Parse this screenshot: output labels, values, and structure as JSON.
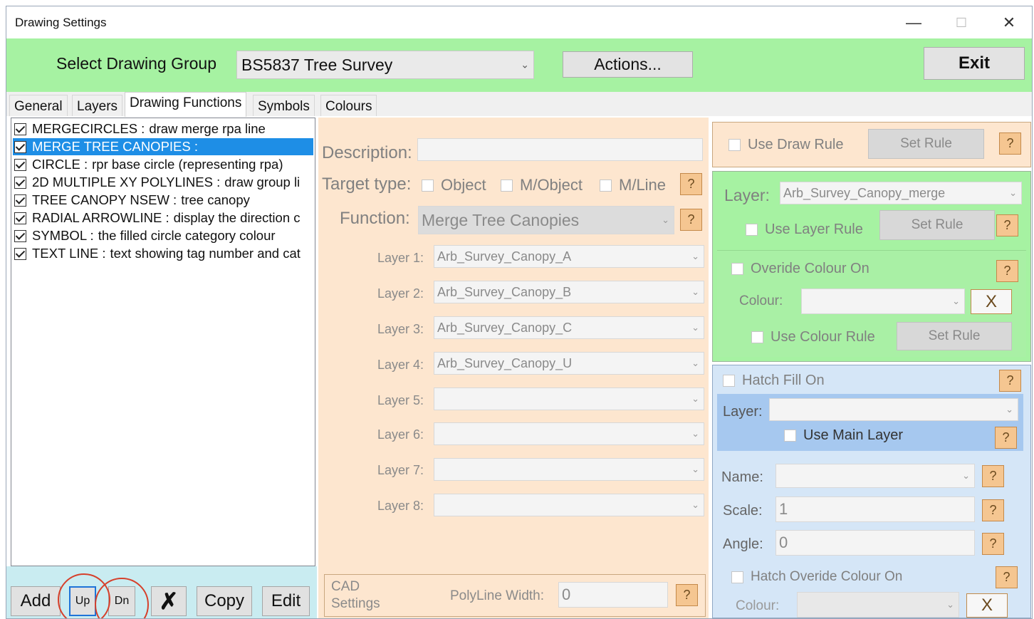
{
  "window": {
    "title": "Drawing Settings",
    "min_glyph": "—",
    "max_glyph": "☐",
    "close_glyph": "✕"
  },
  "topbar": {
    "group_label": "Select Drawing Group",
    "group_value": "BS5837 Tree Survey",
    "actions_label": "Actions...",
    "exit_label": "Exit",
    "bg_color": "#a6f2a2"
  },
  "tabs": [
    {
      "label": "General"
    },
    {
      "label": "Layers"
    },
    {
      "label": "Drawing Functions",
      "active": true
    },
    {
      "label": "Symbols"
    },
    {
      "label": "Colours"
    }
  ],
  "functions": [
    {
      "code": "MERGECIRCLES :",
      "desc": "draw merge rpa line",
      "checked": true
    },
    {
      "code": "MERGE TREE CANOPIES :",
      "desc": "",
      "checked": true,
      "selected": true
    },
    {
      "code": "CIRCLE :",
      "desc": "rpr base circle (representing rpa)",
      "checked": true
    },
    {
      "code": "2D MULTIPLE XY POLYLINES :",
      "desc": "draw group li",
      "checked": true
    },
    {
      "code": "TREE CANOPY NSEW :",
      "desc": "tree canopy",
      "checked": true
    },
    {
      "code": "RADIAL ARROWLINE :",
      "desc": "display the direction c",
      "checked": true
    },
    {
      "code": "SYMBOL :",
      "desc": "the filled circle category colour",
      "checked": true
    },
    {
      "code": "TEXT LINE :",
      "desc": "text showing tag number and cat",
      "checked": true
    }
  ],
  "list_buttons": {
    "add": "Add",
    "up": "Up",
    "down": "Dn",
    "delete": "✗",
    "copy": "Copy",
    "edit": "Edit"
  },
  "detail": {
    "description_label": "Description:",
    "description_value": "",
    "target_type_label": "Target type:",
    "target_options": [
      {
        "label": "Object",
        "checked": false
      },
      {
        "label": "M/Object",
        "checked": false
      },
      {
        "label": "M/Line",
        "checked": false
      }
    ],
    "function_label": "Function:",
    "function_value": "Merge Tree Canopies",
    "help_glyph": "?",
    "layers": [
      {
        "label": "Layer 1:",
        "value": "Arb_Survey_Canopy_A"
      },
      {
        "label": "Layer 2:",
        "value": "Arb_Survey_Canopy_B"
      },
      {
        "label": "Layer 3:",
        "value": "Arb_Survey_Canopy_C"
      },
      {
        "label": "Layer 4:",
        "value": "Arb_Survey_Canopy_U"
      },
      {
        "label": "Layer 5:",
        "value": ""
      },
      {
        "label": "Layer 6:",
        "value": ""
      },
      {
        "label": "Layer 7:",
        "value": ""
      },
      {
        "label": "Layer 8:",
        "value": ""
      }
    ],
    "cad_label_1": "CAD",
    "cad_label_2": "Settings",
    "polyline_width_label": "PolyLine Width:",
    "polyline_width_value": "0",
    "panel_color": "#fde6cf"
  },
  "rules": {
    "use_draw_rule_label": "Use Draw Rule",
    "set_rule_label": "Set Rule",
    "layer_label": "Layer:",
    "layer_value": "Arb_Survey_Canopy_merge",
    "use_layer_rule_label": "Use Layer Rule",
    "override_colour_label": "Overide Colour On",
    "colour_label": "Colour:",
    "colour_value": "",
    "clear_glyph": "X",
    "use_colour_rule_label": "Use Colour Rule",
    "green_color": "#a6f2a2"
  },
  "hatch": {
    "hatch_fill_label": "Hatch Fill On",
    "layer_label": "Layer:",
    "layer_value": "",
    "use_main_layer_label": "Use Main Layer",
    "name_label": "Name:",
    "name_value": "",
    "scale_label": "Scale:",
    "scale_value": "1",
    "angle_label": "Angle:",
    "angle_value": "0",
    "hatch_override_label": "Hatch Overide Colour On",
    "colour_label": "Colour:",
    "colour_value": "",
    "clear_glyph": "X",
    "blue_color": "#d5e6f7"
  }
}
